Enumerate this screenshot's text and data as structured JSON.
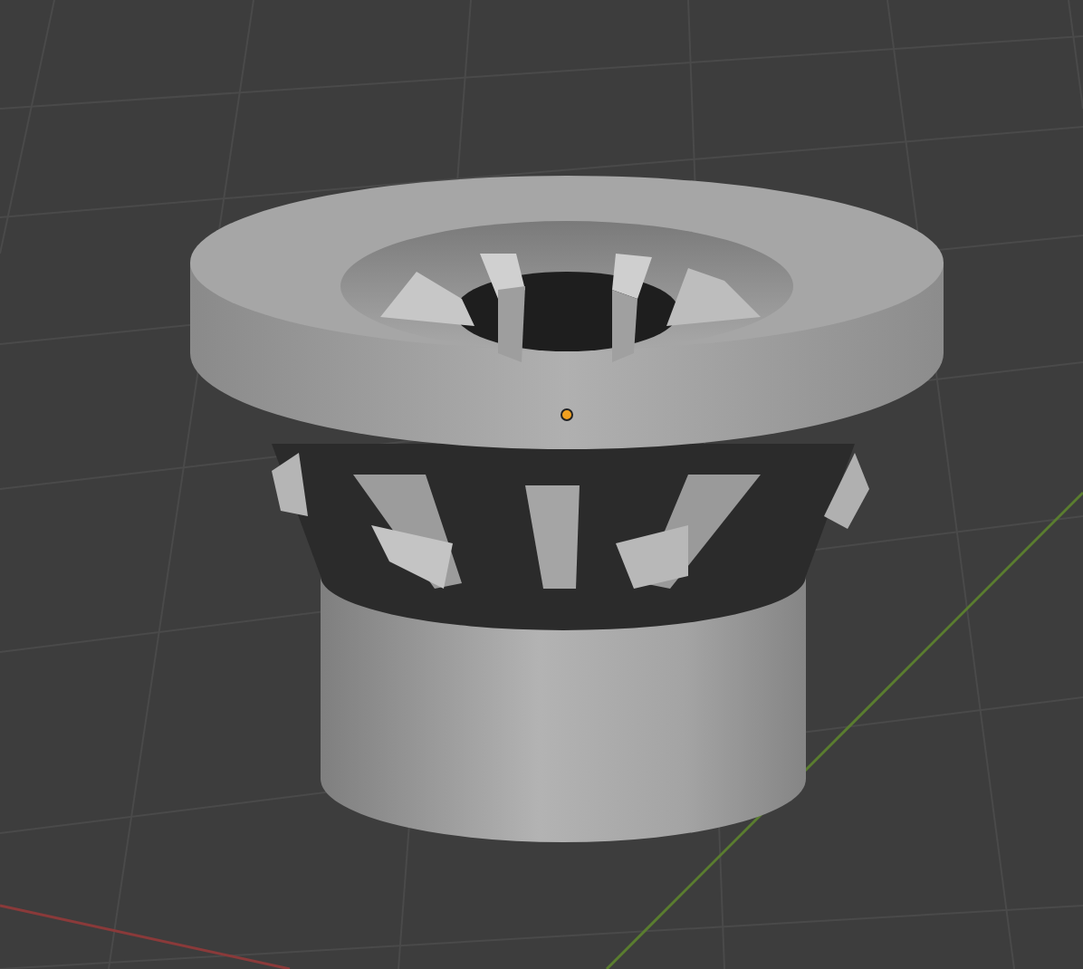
{
  "viewport": {
    "origin_marker": {
      "visible": true
    }
  }
}
